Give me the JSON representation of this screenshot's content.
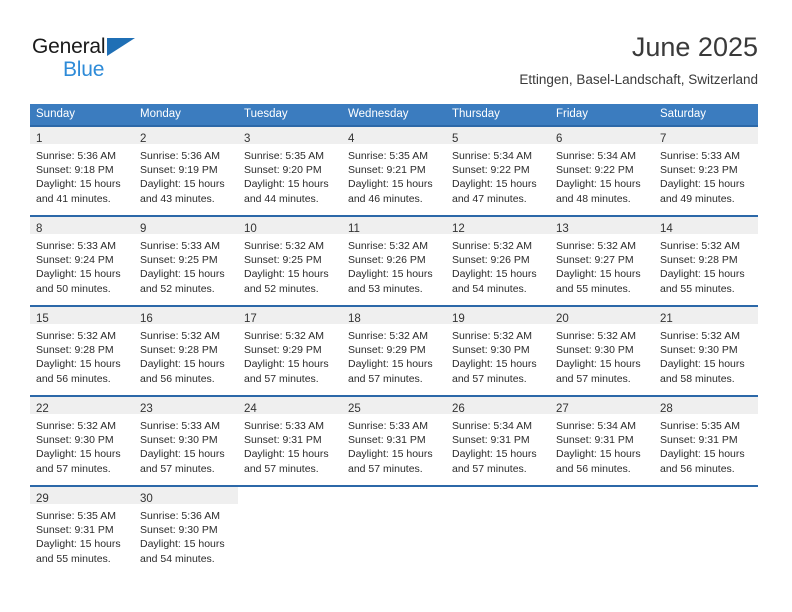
{
  "brand": {
    "name_top": "General",
    "name_bottom": "Blue",
    "accent_dark": "#1f6fb5",
    "accent_light": "#2E8BD8"
  },
  "header": {
    "title": "June 2025",
    "subtitle": "Ettingen, Basel-Landschaft, Switzerland"
  },
  "theme": {
    "header_bg": "#3B7CBF",
    "row_rule": "#2C68A8",
    "daynum_band": "#EFEFEF",
    "text": "#2b2b2b"
  },
  "calendar": {
    "weekday_headers": [
      "Sunday",
      "Monday",
      "Tuesday",
      "Wednesday",
      "Thursday",
      "Friday",
      "Saturday"
    ],
    "weeks": [
      [
        {
          "day": "1",
          "sunrise": "Sunrise: 5:36 AM",
          "sunset": "Sunset: 9:18 PM",
          "daylight_1": "Daylight: 15 hours",
          "daylight_2": "and 41 minutes."
        },
        {
          "day": "2",
          "sunrise": "Sunrise: 5:36 AM",
          "sunset": "Sunset: 9:19 PM",
          "daylight_1": "Daylight: 15 hours",
          "daylight_2": "and 43 minutes."
        },
        {
          "day": "3",
          "sunrise": "Sunrise: 5:35 AM",
          "sunset": "Sunset: 9:20 PM",
          "daylight_1": "Daylight: 15 hours",
          "daylight_2": "and 44 minutes."
        },
        {
          "day": "4",
          "sunrise": "Sunrise: 5:35 AM",
          "sunset": "Sunset: 9:21 PM",
          "daylight_1": "Daylight: 15 hours",
          "daylight_2": "and 46 minutes."
        },
        {
          "day": "5",
          "sunrise": "Sunrise: 5:34 AM",
          "sunset": "Sunset: 9:22 PM",
          "daylight_1": "Daylight: 15 hours",
          "daylight_2": "and 47 minutes."
        },
        {
          "day": "6",
          "sunrise": "Sunrise: 5:34 AM",
          "sunset": "Sunset: 9:22 PM",
          "daylight_1": "Daylight: 15 hours",
          "daylight_2": "and 48 minutes."
        },
        {
          "day": "7",
          "sunrise": "Sunrise: 5:33 AM",
          "sunset": "Sunset: 9:23 PM",
          "daylight_1": "Daylight: 15 hours",
          "daylight_2": "and 49 minutes."
        }
      ],
      [
        {
          "day": "8",
          "sunrise": "Sunrise: 5:33 AM",
          "sunset": "Sunset: 9:24 PM",
          "daylight_1": "Daylight: 15 hours",
          "daylight_2": "and 50 minutes."
        },
        {
          "day": "9",
          "sunrise": "Sunrise: 5:33 AM",
          "sunset": "Sunset: 9:25 PM",
          "daylight_1": "Daylight: 15 hours",
          "daylight_2": "and 52 minutes."
        },
        {
          "day": "10",
          "sunrise": "Sunrise: 5:32 AM",
          "sunset": "Sunset: 9:25 PM",
          "daylight_1": "Daylight: 15 hours",
          "daylight_2": "and 52 minutes."
        },
        {
          "day": "11",
          "sunrise": "Sunrise: 5:32 AM",
          "sunset": "Sunset: 9:26 PM",
          "daylight_1": "Daylight: 15 hours",
          "daylight_2": "and 53 minutes."
        },
        {
          "day": "12",
          "sunrise": "Sunrise: 5:32 AM",
          "sunset": "Sunset: 9:26 PM",
          "daylight_1": "Daylight: 15 hours",
          "daylight_2": "and 54 minutes."
        },
        {
          "day": "13",
          "sunrise": "Sunrise: 5:32 AM",
          "sunset": "Sunset: 9:27 PM",
          "daylight_1": "Daylight: 15 hours",
          "daylight_2": "and 55 minutes."
        },
        {
          "day": "14",
          "sunrise": "Sunrise: 5:32 AM",
          "sunset": "Sunset: 9:28 PM",
          "daylight_1": "Daylight: 15 hours",
          "daylight_2": "and 55 minutes."
        }
      ],
      [
        {
          "day": "15",
          "sunrise": "Sunrise: 5:32 AM",
          "sunset": "Sunset: 9:28 PM",
          "daylight_1": "Daylight: 15 hours",
          "daylight_2": "and 56 minutes."
        },
        {
          "day": "16",
          "sunrise": "Sunrise: 5:32 AM",
          "sunset": "Sunset: 9:28 PM",
          "daylight_1": "Daylight: 15 hours",
          "daylight_2": "and 56 minutes."
        },
        {
          "day": "17",
          "sunrise": "Sunrise: 5:32 AM",
          "sunset": "Sunset: 9:29 PM",
          "daylight_1": "Daylight: 15 hours",
          "daylight_2": "and 57 minutes."
        },
        {
          "day": "18",
          "sunrise": "Sunrise: 5:32 AM",
          "sunset": "Sunset: 9:29 PM",
          "daylight_1": "Daylight: 15 hours",
          "daylight_2": "and 57 minutes."
        },
        {
          "day": "19",
          "sunrise": "Sunrise: 5:32 AM",
          "sunset": "Sunset: 9:30 PM",
          "daylight_1": "Daylight: 15 hours",
          "daylight_2": "and 57 minutes."
        },
        {
          "day": "20",
          "sunrise": "Sunrise: 5:32 AM",
          "sunset": "Sunset: 9:30 PM",
          "daylight_1": "Daylight: 15 hours",
          "daylight_2": "and 57 minutes."
        },
        {
          "day": "21",
          "sunrise": "Sunrise: 5:32 AM",
          "sunset": "Sunset: 9:30 PM",
          "daylight_1": "Daylight: 15 hours",
          "daylight_2": "and 58 minutes."
        }
      ],
      [
        {
          "day": "22",
          "sunrise": "Sunrise: 5:32 AM",
          "sunset": "Sunset: 9:30 PM",
          "daylight_1": "Daylight: 15 hours",
          "daylight_2": "and 57 minutes."
        },
        {
          "day": "23",
          "sunrise": "Sunrise: 5:33 AM",
          "sunset": "Sunset: 9:30 PM",
          "daylight_1": "Daylight: 15 hours",
          "daylight_2": "and 57 minutes."
        },
        {
          "day": "24",
          "sunrise": "Sunrise: 5:33 AM",
          "sunset": "Sunset: 9:31 PM",
          "daylight_1": "Daylight: 15 hours",
          "daylight_2": "and 57 minutes."
        },
        {
          "day": "25",
          "sunrise": "Sunrise: 5:33 AM",
          "sunset": "Sunset: 9:31 PM",
          "daylight_1": "Daylight: 15 hours",
          "daylight_2": "and 57 minutes."
        },
        {
          "day": "26",
          "sunrise": "Sunrise: 5:34 AM",
          "sunset": "Sunset: 9:31 PM",
          "daylight_1": "Daylight: 15 hours",
          "daylight_2": "and 57 minutes."
        },
        {
          "day": "27",
          "sunrise": "Sunrise: 5:34 AM",
          "sunset": "Sunset: 9:31 PM",
          "daylight_1": "Daylight: 15 hours",
          "daylight_2": "and 56 minutes."
        },
        {
          "day": "28",
          "sunrise": "Sunrise: 5:35 AM",
          "sunset": "Sunset: 9:31 PM",
          "daylight_1": "Daylight: 15 hours",
          "daylight_2": "and 56 minutes."
        }
      ],
      [
        {
          "day": "29",
          "sunrise": "Sunrise: 5:35 AM",
          "sunset": "Sunset: 9:31 PM",
          "daylight_1": "Daylight: 15 hours",
          "daylight_2": "and 55 minutes."
        },
        {
          "day": "30",
          "sunrise": "Sunrise: 5:36 AM",
          "sunset": "Sunset: 9:30 PM",
          "daylight_1": "Daylight: 15 hours",
          "daylight_2": "and 54 minutes."
        },
        {
          "day": "",
          "sunrise": "",
          "sunset": "",
          "daylight_1": "",
          "daylight_2": ""
        },
        {
          "day": "",
          "sunrise": "",
          "sunset": "",
          "daylight_1": "",
          "daylight_2": ""
        },
        {
          "day": "",
          "sunrise": "",
          "sunset": "",
          "daylight_1": "",
          "daylight_2": ""
        },
        {
          "day": "",
          "sunrise": "",
          "sunset": "",
          "daylight_1": "",
          "daylight_2": ""
        },
        {
          "day": "",
          "sunrise": "",
          "sunset": "",
          "daylight_1": "",
          "daylight_2": ""
        }
      ]
    ]
  }
}
